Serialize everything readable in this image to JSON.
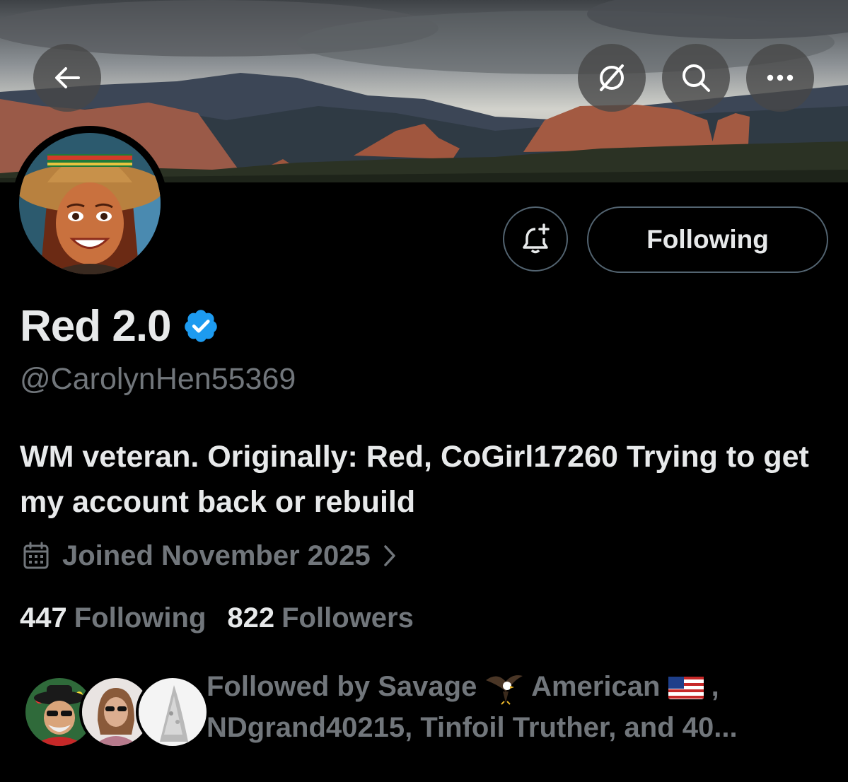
{
  "header": {
    "back_icon": "arrow-left-icon",
    "grok_icon": "grok-icon",
    "search_icon": "search-icon",
    "more_icon": "more-horizontal-icon"
  },
  "profile": {
    "display_name": "Red 2.0",
    "handle": "@CarolynHen55369",
    "bio": "WM veteran. Originally: Red, CoGirl17260 Trying to get my account back or rebuild",
    "joined": "Joined November 2025",
    "verified_color": "#1d9bf0",
    "following_button_label": "Following"
  },
  "stats": {
    "following_count": "447",
    "following_label": "Following",
    "followers_count": "822",
    "followers_label": "Followers"
  },
  "followed_by": {
    "prefix": "Followed by Savage",
    "name1_suffix": "American",
    "line2": "NDgrand40215, Tinfoil Truther, and 40..."
  },
  "colors": {
    "background": "#000000",
    "primary_text": "#e7e9ea",
    "secondary_text": "#71767b",
    "border": "#536471",
    "accent": "#1d9bf0"
  }
}
